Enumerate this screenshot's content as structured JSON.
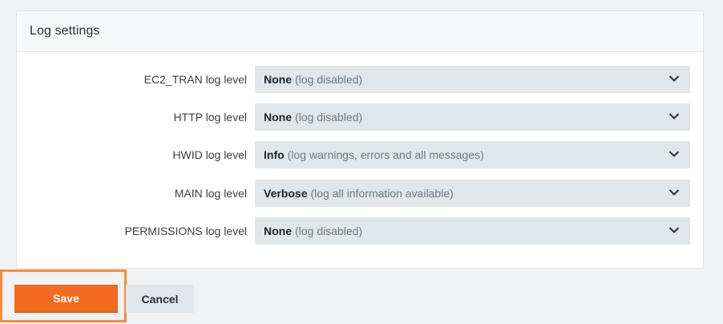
{
  "panel": {
    "title": "Log settings"
  },
  "log_levels": [
    {
      "label": "EC2_TRAN log level",
      "value": "None",
      "description": "(log disabled)"
    },
    {
      "label": "HTTP log level",
      "value": "None",
      "description": "(log disabled)"
    },
    {
      "label": "HWID log level",
      "value": "Info",
      "description": "(log warnings, errors and all messages)"
    },
    {
      "label": "MAIN log level",
      "value": "Verbose",
      "description": "(log all information available)"
    },
    {
      "label": "PERMISSIONS log level",
      "value": "None",
      "description": "(log disabled)"
    }
  ],
  "actions": {
    "save_label": "Save",
    "cancel_label": "Cancel"
  },
  "colors": {
    "accent": "#f26b20",
    "highlight_border": "#f68d3a",
    "select_bg": "#e1e6ea"
  },
  "icons": {
    "select_caret": "chevron-down-icon"
  }
}
